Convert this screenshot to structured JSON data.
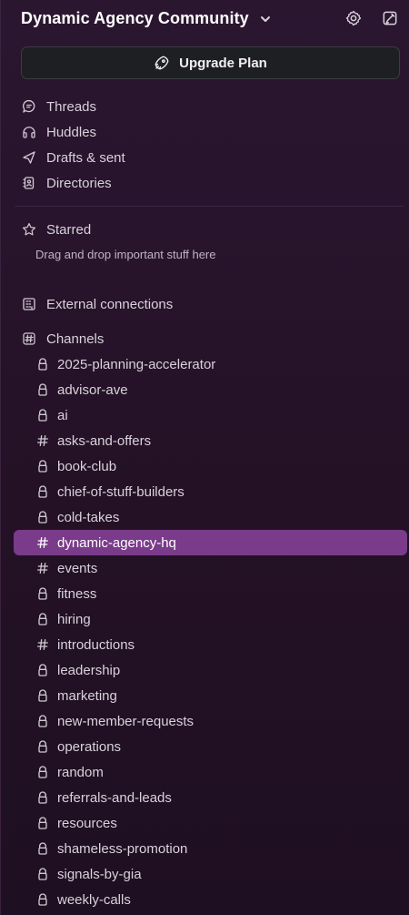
{
  "header": {
    "workspace_title": "Dynamic Agency Community",
    "icons": {
      "chevron": "chevron-down-icon",
      "settings": "gear-icon",
      "compose": "compose-icon"
    }
  },
  "upgrade": {
    "label": "Upgrade Plan",
    "icon": "rocket-icon"
  },
  "nav": {
    "items": [
      {
        "label": "Threads",
        "icon": "threads-icon"
      },
      {
        "label": "Huddles",
        "icon": "headphones-icon"
      },
      {
        "label": "Drafts & sent",
        "icon": "send-icon"
      },
      {
        "label": "Directories",
        "icon": "contacts-icon"
      }
    ]
  },
  "starred": {
    "label": "Starred",
    "hint": "Drag and drop important stuff here",
    "icon": "star-icon"
  },
  "external": {
    "label": "External connections",
    "icon": "building-icon"
  },
  "channels": {
    "label": "Channels",
    "icon": "hash-square-icon",
    "items": [
      {
        "name": "2025-planning-accelerator",
        "type": "private"
      },
      {
        "name": "advisor-ave",
        "type": "private"
      },
      {
        "name": "ai",
        "type": "private"
      },
      {
        "name": "asks-and-offers",
        "type": "public"
      },
      {
        "name": "book-club",
        "type": "private"
      },
      {
        "name": "chief-of-stuff-builders",
        "type": "private"
      },
      {
        "name": "cold-takes",
        "type": "private"
      },
      {
        "name": "dynamic-agency-hq",
        "type": "public",
        "active": true
      },
      {
        "name": "events",
        "type": "public"
      },
      {
        "name": "fitness",
        "type": "private"
      },
      {
        "name": "hiring",
        "type": "private"
      },
      {
        "name": "introductions",
        "type": "public"
      },
      {
        "name": "leadership",
        "type": "private"
      },
      {
        "name": "marketing",
        "type": "private"
      },
      {
        "name": "new-member-requests",
        "type": "private"
      },
      {
        "name": "operations",
        "type": "private"
      },
      {
        "name": "random",
        "type": "private"
      },
      {
        "name": "referrals-and-leads",
        "type": "private"
      },
      {
        "name": "resources",
        "type": "private"
      },
      {
        "name": "shameless-promotion",
        "type": "private"
      },
      {
        "name": "signals-by-gia",
        "type": "private"
      },
      {
        "name": "weekly-calls",
        "type": "private"
      }
    ]
  },
  "colors": {
    "active_channel_bg": "#7a3b8a"
  }
}
